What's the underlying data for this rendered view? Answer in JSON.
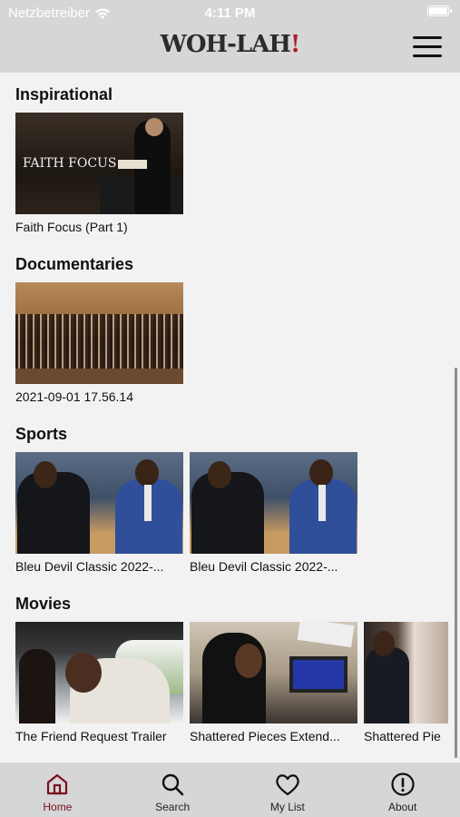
{
  "status_bar": {
    "carrier": "Netzbetreiber",
    "time": "4:11 PM"
  },
  "header": {
    "logo_text": "WOH-LAH",
    "logo_exclaim": "!",
    "menu_icon": "hamburger-menu-icon"
  },
  "sections": [
    {
      "title": "Inspirational",
      "items": [
        {
          "caption": "Faith Focus (Part 1)",
          "thumb_text": "FAITH FOCUS"
        }
      ]
    },
    {
      "title": "Documentaries",
      "items": [
        {
          "caption": "2021-09-01 17.56.14"
        }
      ]
    },
    {
      "title": "Sports",
      "items": [
        {
          "caption": "Bleu Devil Classic 2022-..."
        },
        {
          "caption": "Bleu Devil Classic 2022-..."
        }
      ]
    },
    {
      "title": "Movies",
      "items": [
        {
          "caption": "The Friend Request Trailer"
        },
        {
          "caption": "Shattered Pieces Extend..."
        },
        {
          "caption": "Shattered Pie"
        }
      ]
    }
  ],
  "tabbar": {
    "active": "Home",
    "accent": "#7a0f1e",
    "tabs": [
      {
        "label": "Home",
        "icon": "home-icon"
      },
      {
        "label": "Search",
        "icon": "search-icon"
      },
      {
        "label": "My List",
        "icon": "heart-icon"
      },
      {
        "label": "About",
        "icon": "info-icon"
      }
    ]
  }
}
